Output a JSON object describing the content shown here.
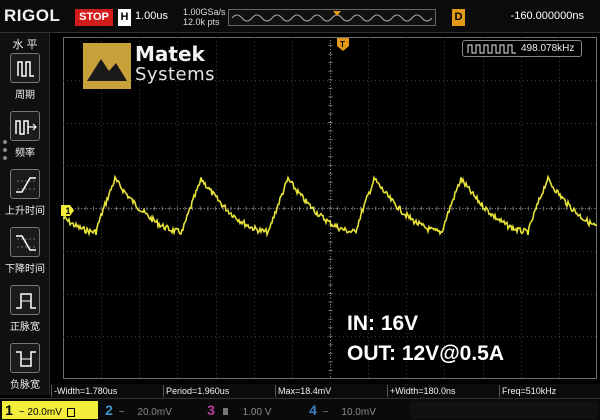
{
  "topbar": {
    "brand": "RIGOL",
    "status": "STOP",
    "horizontal_key": "H",
    "timebase": "1.00us",
    "sample_rate": "1.00GSa/s",
    "memory_depth": "12.0k pts",
    "delay_key": "D",
    "delay": "-160.000000ns"
  },
  "menu": {
    "title": "水 平",
    "items": [
      {
        "label": "周期",
        "icon": "period-icon"
      },
      {
        "label": "频率",
        "icon": "frequency-icon"
      },
      {
        "label": "上升时间",
        "icon": "rise-time-icon"
      },
      {
        "label": "下降时间",
        "icon": "fall-time-icon"
      },
      {
        "label": "正脉宽",
        "icon": "positive-width-icon"
      },
      {
        "label": "负脉宽",
        "icon": "negative-width-icon"
      }
    ]
  },
  "screen": {
    "logo_name": "Matek",
    "logo_sub": "Systems",
    "freq_counter": "498.078kHz",
    "trigger_marker": "T",
    "channel_marker": "1",
    "overlay_line1": "IN: 16V",
    "overlay_line2": "OUT: 12V@0.5A",
    "trace_color": "#f2ee3b"
  },
  "measurements": [
    "-Width=1.780us",
    "Period=1.960us",
    "Max=18.4mV",
    "+Width=180.0ns",
    "Freq=510kHz"
  ],
  "channels": [
    {
      "num": "1",
      "scale": "20.0mV",
      "color": "#f2ee3b",
      "active": true
    },
    {
      "num": "2",
      "scale": "20.0mV",
      "color": "#3e93c6",
      "active": false
    },
    {
      "num": "3",
      "scale": "1.00 V",
      "color": "#b73b9a",
      "active": false
    },
    {
      "num": "4",
      "scale": "10.0mV",
      "color": "#3d7fc4",
      "active": false
    }
  ]
}
